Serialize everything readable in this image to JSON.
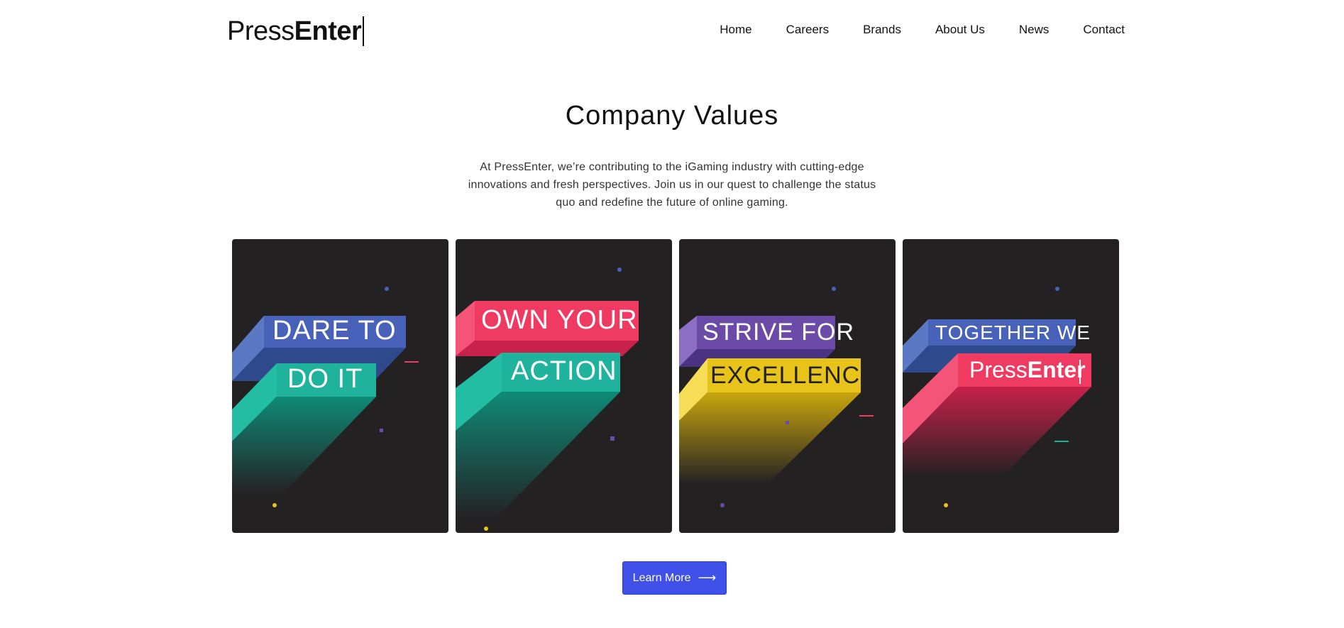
{
  "brand": {
    "logo_light": "Press",
    "logo_bold": "Enter"
  },
  "nav": {
    "items": [
      "Home",
      "Careers",
      "Brands",
      "About Us",
      "News",
      "Contact"
    ]
  },
  "section": {
    "title": "Company Values",
    "intro": "At PressEnter, we’re contributing to the iGaming industry with cutting-edge innovations and fresh perspectives. Join us in our quest to challenge the status quo and redefine the future of online gaming."
  },
  "cards": [
    {
      "line1": "DARE TO",
      "line2": "DO IT",
      "color1": "#4762b8",
      "color2": "#1fb39d"
    },
    {
      "line1": "OWN YOUR",
      "line2": "ACTION",
      "color1": "#ef3a62",
      "color2": "#1fb39d"
    },
    {
      "line1": "STRIVE FOR",
      "line2": "EXCELLENCE",
      "color1": "#6b4aa8",
      "color2": "#e8c41a"
    },
    {
      "line1": "TOGETHER WE",
      "line2_light": "Press",
      "line2_bold": "Enter",
      "color1": "#4762b8",
      "color2": "#ef3a62"
    }
  ],
  "cta": {
    "label": "Learn More",
    "arrow_icon": "arrow-right-icon"
  },
  "colors": {
    "accent": "#3f51e8",
    "card_bg": "#242123"
  }
}
